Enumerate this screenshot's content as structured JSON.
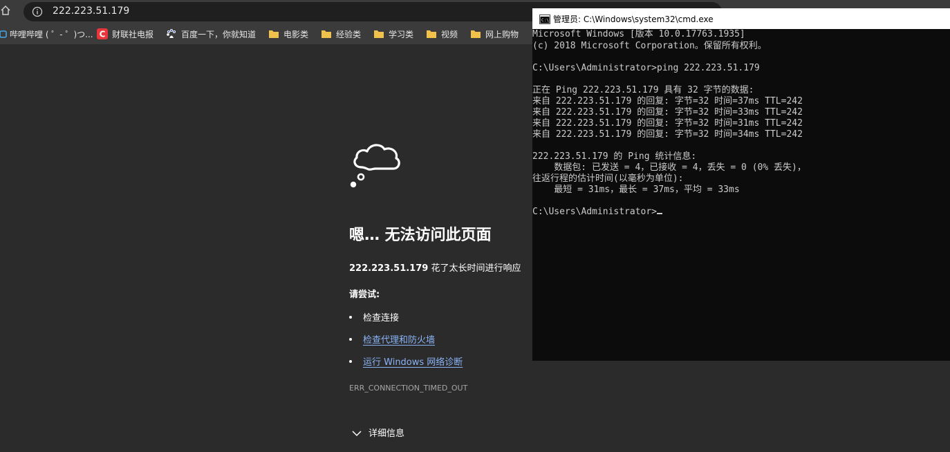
{
  "browser": {
    "url": "222.223.51.179",
    "bookmarks": [
      {
        "label": "哔哩哔哩 ( ゜- ゜)つ...",
        "icon": "bilibili-icon"
      },
      {
        "label": "财联社电报",
        "icon": "cls-icon"
      },
      {
        "label": "百度一下，你就知道",
        "icon": "baidu-icon"
      },
      {
        "label": "电影类",
        "icon": "folder-icon"
      },
      {
        "label": "经验类",
        "icon": "folder-icon"
      },
      {
        "label": "学习类",
        "icon": "folder-icon"
      },
      {
        "label": "视频",
        "icon": "folder-icon"
      },
      {
        "label": "网上购物",
        "icon": "folder-icon"
      }
    ]
  },
  "error_page": {
    "title": "嗯… 无法访问此页面",
    "host": "222.223.51.179",
    "subtitle_rest": " 花了太长时间进行响应",
    "try_label": "请尝试:",
    "suggestions": [
      "检查连接",
      "检查代理和防火墙",
      "运行 Windows 网络诊断"
    ],
    "error_code": "ERR_CONNECTION_TIMED_OUT",
    "details_label": "详细信息"
  },
  "cmd": {
    "title": "管理员: C:\\Windows\\system32\\cmd.exe",
    "lines": [
      "Microsoft Windows [版本 10.0.17763.1935]",
      "(c) 2018 Microsoft Corporation。保留所有权利。",
      "",
      "C:\\Users\\Administrator>ping 222.223.51.179",
      "",
      "正在 Ping 222.223.51.179 具有 32 字节的数据:",
      "来自 222.223.51.179 的回复: 字节=32 时间=37ms TTL=242",
      "来自 222.223.51.179 的回复: 字节=32 时间=33ms TTL=242",
      "来自 222.223.51.179 的回复: 字节=32 时间=31ms TTL=242",
      "来自 222.223.51.179 的回复: 字节=32 时间=34ms TTL=242",
      "",
      "222.223.51.179 的 Ping 统计信息:",
      "    数据包: 已发送 = 4，已接收 = 4，丢失 = 0 (0% 丢失)，",
      "往返行程的估计时间(以毫秒为单位):",
      "    最短 = 31ms，最长 = 37ms，平均 = 33ms",
      "",
      "C:\\Users\\Administrator>"
    ]
  },
  "colors": {
    "page_bg": "#2b2b2b",
    "toolbar_bg": "#3b3b3b",
    "link": "#8ab4f8",
    "console_bg": "#0c0c0c",
    "console_text": "#cccccc"
  }
}
